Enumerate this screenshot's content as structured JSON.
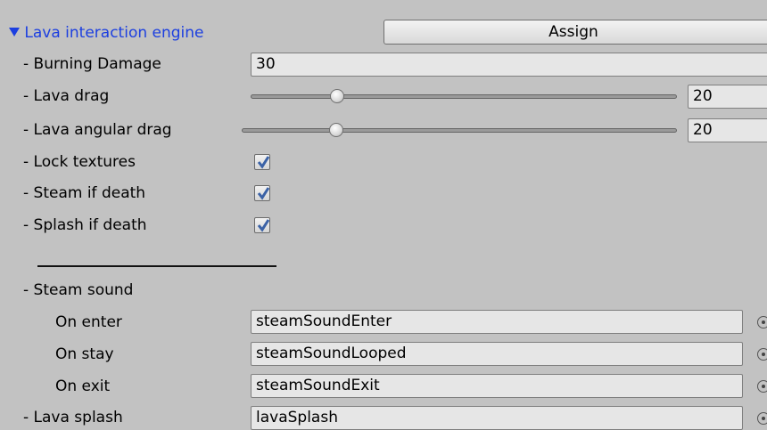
{
  "header": {
    "foldout_label": "Lava interaction engine",
    "assign_label": "Assign",
    "accent_color": "#1c3fe0"
  },
  "fields": {
    "burning_damage": {
      "label": "- Burning Damage",
      "value": "30"
    },
    "lava_drag": {
      "label": "- Lava drag",
      "value": "20"
    },
    "lava_angular_drag": {
      "label": "- Lava angular drag",
      "value": "20"
    },
    "lock_textures": {
      "label": "- Lock textures",
      "checked": true
    },
    "steam_if_death": {
      "label": "- Steam if death",
      "checked": true
    },
    "splash_if_death": {
      "label": "- Splash if death",
      "checked": true
    }
  },
  "steam_sound": {
    "label": "- Steam sound",
    "on_enter": {
      "label": "On enter",
      "value": "steamSoundEnter"
    },
    "on_stay": {
      "label": "On stay",
      "value": "steamSoundLooped"
    },
    "on_exit": {
      "label": "On exit",
      "value": "steamSoundExit"
    }
  },
  "lava_splash": {
    "label": "- Lava splash",
    "value": "lavaSplash"
  },
  "icons": {
    "foldout": "triangle-down-icon",
    "check": "checkmark-icon",
    "object_picker": "object-picker-icon"
  }
}
